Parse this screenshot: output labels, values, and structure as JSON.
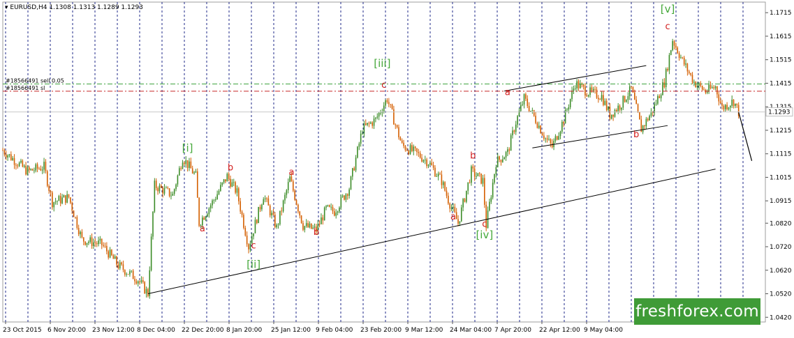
{
  "header": {
    "symbol_timeframe": "EURUSD,H4",
    "ohlc": [
      "1.1308",
      "1.1313",
      "1.1289",
      "1.1293"
    ]
  },
  "brand": {
    "text": "freshforex.com",
    "color": "#3f9b37"
  },
  "colors": {
    "candle": "#d45f00",
    "candle_up": "#3c8c28",
    "wave_letter": "#d21e1e",
    "wave_major": "#45a83a",
    "vgrid": "#1f2a8a",
    "sell_line": "#3fa33f",
    "sl_line": "#c62828",
    "price_box": "#ffffff",
    "price_box_border": "#bdbdbd"
  },
  "chart_data": {
    "type": "candlestick",
    "title": "",
    "symbol": "EURUSD",
    "timeframe": "H4",
    "x_labels": [
      "23 Oct 2015",
      "6 Nov 20:00",
      "23 Nov 12:00",
      "8 Dec 04:00",
      "22 Dec 20:00",
      "8 Jan 20:00",
      "25 Jan 12:00",
      "9 Feb 04:00",
      "23 Feb 20:00",
      "9 Mar 12:00",
      "24 Mar 04:00",
      "7 Apr 20:00",
      "22 Apr 12:00",
      "9 May 04:00"
    ],
    "y_ticks": [
      "1.1715",
      "1.1615",
      "1.1515",
      "1.1415",
      "1.1315",
      "1.1215",
      "1.1115",
      "1.1015",
      "1.0915",
      "1.0820",
      "1.0720",
      "1.0620",
      "1.0520",
      "1.0420"
    ],
    "ylim": [
      1.04,
      1.176
    ],
    "current_price": "1.1293",
    "order_lines": [
      {
        "label": "#18566491 sell 0.05",
        "price": 1.1412,
        "style": "dash-dot",
        "color": "green"
      },
      {
        "label": "#18566491 sl",
        "price": 1.1381,
        "style": "dash-dot",
        "color": "red"
      }
    ],
    "price_path": [
      [
        0,
        1.113
      ],
      [
        1.5,
        1.104
      ],
      [
        2.5,
        1.106
      ],
      [
        3,
        1.091
      ],
      [
        4,
        1.093
      ],
      [
        4.8,
        1.075
      ],
      [
        6,
        1.073
      ],
      [
        7,
        1.064
      ],
      [
        8.2,
        1.058
      ],
      [
        8.8,
        1.052
      ],
      [
        9.2,
        1.098
      ],
      [
        10.3,
        1.094
      ],
      [
        10.9,
        1.11
      ],
      [
        11.7,
        1.102
      ],
      [
        11.9,
        1.082
      ],
      [
        12.8,
        1.092
      ],
      [
        13.6,
        1.102
      ],
      [
        14.2,
        1.095
      ],
      [
        14.9,
        1.072
      ],
      [
        15.8,
        1.094
      ],
      [
        16.6,
        1.08
      ],
      [
        17.4,
        1.101
      ],
      [
        18.2,
        1.081
      ],
      [
        19,
        1.079
      ],
      [
        19.6,
        1.088
      ],
      [
        20.1,
        1.087
      ],
      [
        21,
        1.097
      ],
      [
        21.8,
        1.122
      ],
      [
        22.6,
        1.126
      ],
      [
        23.3,
        1.135
      ],
      [
        24.2,
        1.115
      ],
      [
        25,
        1.112
      ],
      [
        25.8,
        1.108
      ],
      [
        26.6,
        1.1
      ],
      [
        27,
        1.092
      ],
      [
        27.6,
        1.082
      ],
      [
        28.4,
        1.104
      ],
      [
        29.1,
        1.1
      ],
      [
        29.3,
        1.081
      ],
      [
        29.9,
        1.108
      ],
      [
        30.6,
        1.112
      ],
      [
        31.1,
        1.125
      ],
      [
        31.6,
        1.135
      ],
      [
        32.3,
        1.126
      ],
      [
        32.9,
        1.118
      ],
      [
        33.3,
        1.1145
      ],
      [
        34,
        1.126
      ],
      [
        34.7,
        1.1415
      ],
      [
        35.4,
        1.138
      ],
      [
        36.3,
        1.136
      ],
      [
        36.8,
        1.128
      ],
      [
        37.4,
        1.132
      ],
      [
        38.1,
        1.139
      ],
      [
        38.7,
        1.122
      ],
      [
        39.4,
        1.13
      ],
      [
        40.1,
        1.142
      ],
      [
        40.6,
        1.16
      ],
      [
        41.2,
        1.151
      ],
      [
        41.9,
        1.142
      ],
      [
        42.6,
        1.138
      ],
      [
        43.2,
        1.14
      ],
      [
        43.6,
        1.131
      ],
      [
        44.3,
        1.134
      ],
      [
        44.6,
        1.1293
      ]
    ],
    "projection": [
      [
        44.6,
        1.1293
      ],
      [
        45.4,
        1.1085
      ]
    ],
    "trend_lines": [
      {
        "from": [
          8.8,
          1.052
        ],
        "to": [
          43.2,
          1.105
        ]
      },
      {
        "from": [
          30.4,
          1.1382
        ],
        "to": [
          39,
          1.149
        ]
      },
      {
        "from": [
          32.1,
          1.114
        ],
        "to": [
          40.3,
          1.1235
        ]
      }
    ],
    "annotations": [
      {
        "text": "[i]",
        "x": 11.2,
        "price": 1.1125,
        "kind": "major"
      },
      {
        "text": "b",
        "x": 13.8,
        "price": 1.1045,
        "kind": "minor"
      },
      {
        "text": "a",
        "x": 12.1,
        "price": 1.0785,
        "kind": "minor"
      },
      {
        "text": "c",
        "x": 15.2,
        "price": 1.0712,
        "kind": "minor"
      },
      {
        "text": "[ii]",
        "x": 15.2,
        "price": 1.063,
        "kind": "major"
      },
      {
        "text": "a",
        "x": 17.5,
        "price": 1.1025,
        "kind": "minor"
      },
      {
        "text": "b",
        "x": 19.0,
        "price": 1.077,
        "kind": "minor"
      },
      {
        "text": "[iii]",
        "x": 23.0,
        "price": 1.1485,
        "kind": "major"
      },
      {
        "text": "c",
        "x": 23.1,
        "price": 1.1395,
        "kind": "minor"
      },
      {
        "text": "b",
        "x": 28.5,
        "price": 1.1095,
        "kind": "minor"
      },
      {
        "text": "a",
        "x": 27.3,
        "price": 1.0835,
        "kind": "minor"
      },
      {
        "text": "c",
        "x": 29.2,
        "price": 1.0805,
        "kind": "minor"
      },
      {
        "text": "[iv]",
        "x": 29.2,
        "price": 1.0755,
        "kind": "major"
      },
      {
        "text": "a",
        "x": 30.6,
        "price": 1.1365,
        "kind": "minor"
      },
      {
        "text": "b",
        "x": 38.4,
        "price": 1.1185,
        "kind": "minor"
      },
      {
        "text": "[v]",
        "x": 40.3,
        "price": 1.1715,
        "kind": "major"
      },
      {
        "text": "c",
        "x": 40.3,
        "price": 1.1645,
        "kind": "minor"
      }
    ]
  }
}
